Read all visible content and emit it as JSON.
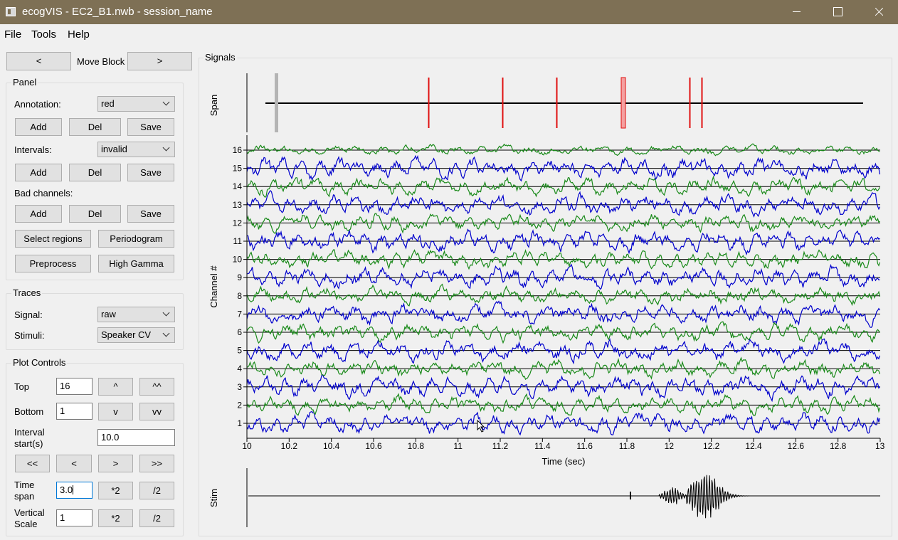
{
  "window": {
    "title": "ecogVIS - EC2_B1.nwb - session_name"
  },
  "menu": [
    "File",
    "Tools",
    "Help"
  ],
  "move_block": {
    "prev": "<",
    "label": "Move Block",
    "next": ">"
  },
  "panel": {
    "title": "Panel",
    "annotation_label": "Annotation:",
    "annotation_value": "red",
    "intervals_label": "Intervals:",
    "intervals_value": "invalid",
    "bad_channels_label": "Bad channels:",
    "add": "Add",
    "del": "Del",
    "save": "Save",
    "select_regions": "Select regions",
    "periodogram": "Periodogram",
    "preprocess": "Preprocess",
    "high_gamma": "High Gamma"
  },
  "traces": {
    "title": "Traces",
    "signal_label": "Signal:",
    "signal_value": "raw",
    "stimuli_label": "Stimuli:",
    "stimuli_value": "Speaker CV"
  },
  "plot_controls": {
    "title": "Plot Controls",
    "top_label": "Top",
    "top_value": "16",
    "up": "^",
    "up2": "^^",
    "bottom_label": "Bottom",
    "bottom_value": "1",
    "down": "v",
    "down2": "vv",
    "interval_label_1": "Interval",
    "interval_label_2": "start(s)",
    "interval_value": "10.0",
    "first": "<<",
    "prev": "<",
    "next": ">",
    "last": ">>",
    "time_label_1": "Time",
    "time_label_2": "span",
    "time_value": "3.0",
    "times2": "*2",
    "div2": "/2",
    "vscale_label_1": "Vertical",
    "vscale_label_2": "Scale",
    "vscale_value": "1"
  },
  "signals": {
    "title": "Signals",
    "span_label": "Span",
    "channel_label": "Channel #",
    "time_label": "Time (sec)",
    "stim_label": "Stim",
    "channel_ticks": [
      "1",
      "2",
      "3",
      "4",
      "5",
      "6",
      "7",
      "8",
      "9",
      "10",
      "11",
      "12",
      "13",
      "14",
      "15",
      "16"
    ],
    "time_ticks": [
      "10",
      "10.2",
      "10.4",
      "10.6",
      "10.8",
      "11",
      "11.2",
      "11.4",
      "11.6",
      "11.8",
      "12",
      "12.2",
      "12.4",
      "12.6",
      "12.8",
      "13"
    ],
    "colors": {
      "blue": "#0000cc",
      "green": "#1a8a1a",
      "red": "#e01010",
      "grey": "#b4b4b4"
    }
  }
}
